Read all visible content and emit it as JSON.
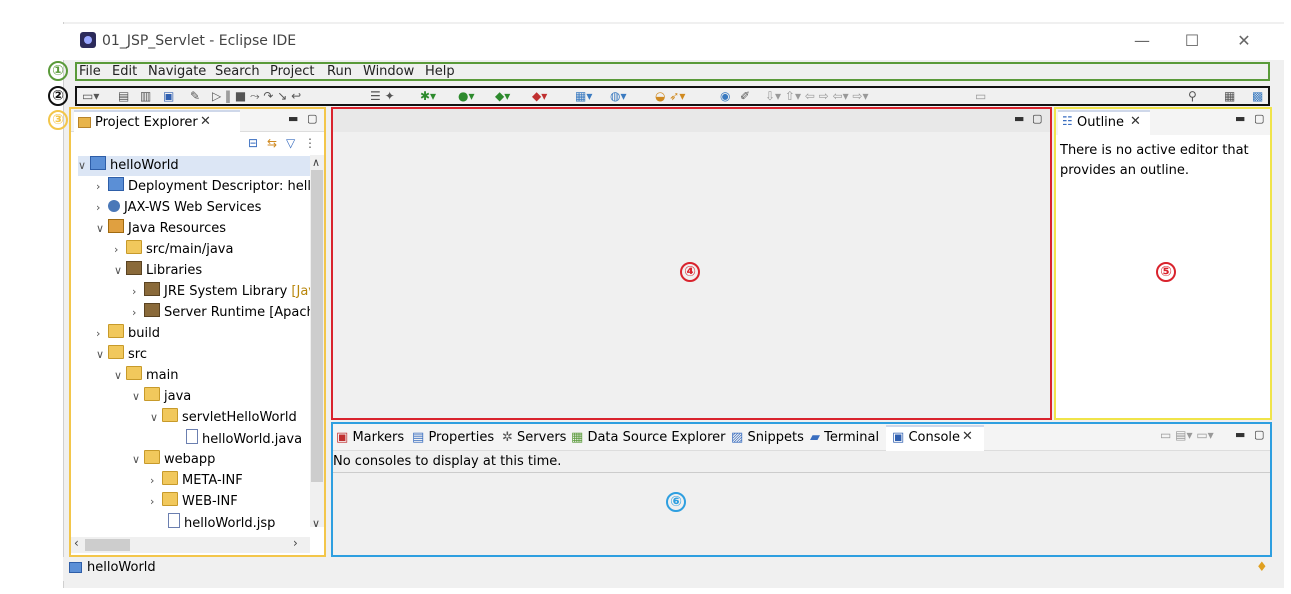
{
  "window": {
    "title": "01_JSP_Servlet - Eclipse IDE",
    "min": "—",
    "max": "☐",
    "close": "✕"
  },
  "menu": [
    "File",
    "Edit",
    "Navigate",
    "Search",
    "Project",
    "Run",
    "Window",
    "Help"
  ],
  "markers": {
    "m1": "①",
    "m2": "②",
    "m3": "③",
    "m4": "④",
    "m5": "⑤",
    "m6": "⑥"
  },
  "colors": {
    "menu": "#5a9a3a",
    "toolbar": "#111111",
    "explorer": "#f3c64a",
    "editor": "#d9232d",
    "outline": "#f0e44a",
    "console": "#2e9fe0"
  },
  "explorer": {
    "tab": "Project Explorer",
    "items": [
      {
        "label": "helloWorld",
        "suffix": ""
      },
      {
        "label": "Deployment Descriptor: hello",
        "suffix": ""
      },
      {
        "label": "JAX-WS Web Services",
        "suffix": ""
      },
      {
        "label": "Java Resources",
        "suffix": ""
      },
      {
        "label": "src/main/java",
        "suffix": ""
      },
      {
        "label": "Libraries",
        "suffix": ""
      },
      {
        "label": "JRE System Library ",
        "suffix": "[Jav"
      },
      {
        "label": "Server Runtime [Apach",
        "suffix": ""
      },
      {
        "label": "build",
        "suffix": ""
      },
      {
        "label": "src",
        "suffix": ""
      },
      {
        "label": "main",
        "suffix": ""
      },
      {
        "label": "java",
        "suffix": ""
      },
      {
        "label": "servletHelloWorld",
        "suffix": ""
      },
      {
        "label": "helloWorld.java",
        "suffix": ""
      },
      {
        "label": "webapp",
        "suffix": ""
      },
      {
        "label": "META-INF",
        "suffix": ""
      },
      {
        "label": "WEB-INF",
        "suffix": ""
      },
      {
        "label": "helloWorld.jsp",
        "suffix": ""
      }
    ]
  },
  "outline": {
    "tab": "Outline",
    "message": "There is no active editor that provides an outline."
  },
  "console": {
    "tabs": [
      "Markers",
      "Properties",
      "Servers",
      "Data Source Explorer",
      "Snippets",
      "Terminal",
      "Console"
    ],
    "message": "No consoles to display at this time."
  },
  "status": {
    "project": "helloWorld"
  }
}
